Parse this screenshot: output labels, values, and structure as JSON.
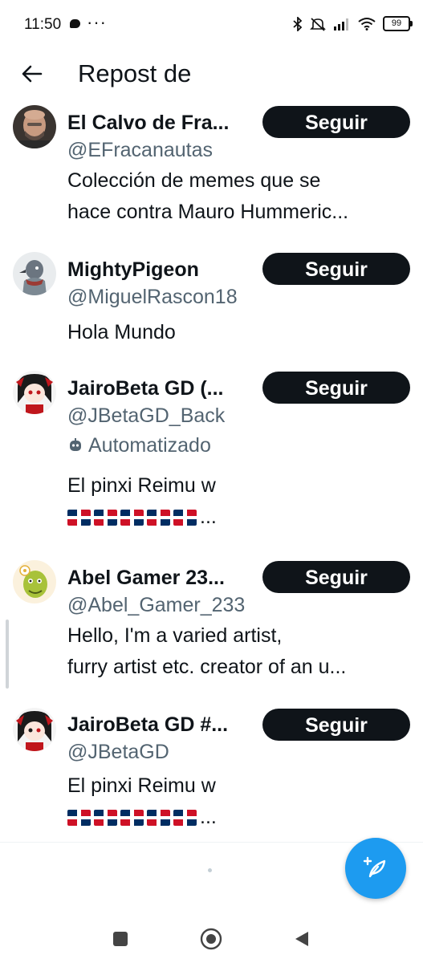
{
  "status_bar": {
    "time": "11:50",
    "dots": "···",
    "battery": "99",
    "icons": [
      "chat-icon",
      "bluetooth-icon",
      "mute-icon",
      "signal-icon",
      "wifi-icon",
      "battery-icon"
    ]
  },
  "header": {
    "title": "Repost de",
    "back_icon": "arrow-left-icon"
  },
  "users": [
    {
      "name": "El Calvo de Fra...",
      "handle": "@EFracanautas",
      "follow_label": "Seguir",
      "bio": [
        "Colección de memes que se",
        "hace contra Mauro Hummeric..."
      ]
    },
    {
      "name": "MightyPigeon",
      "handle": "@MiguelRascon18",
      "follow_label": "Seguir",
      "bio": [
        "Hola Mundo"
      ]
    },
    {
      "name": "JairoBeta GD (...",
      "handle": "@JBetaGD_Back",
      "follow_label": "Seguir",
      "automated_label": "Automatizado",
      "bio": [
        "El pinxi Reimu w"
      ],
      "bio_flags_suffix": "..."
    },
    {
      "name": "Abel Gamer 23...",
      "handle": "@Abel_Gamer_233",
      "follow_label": "Seguir",
      "bio": [
        "Hello, I'm a varied artist,",
        "furry artist etc. creator of an u..."
      ]
    },
    {
      "name": "JairoBeta GD #...",
      "handle": "@JBetaGD",
      "follow_label": "Seguir",
      "bio": [
        "El pinxi Reimu w"
      ],
      "bio_flags_suffix": "..."
    }
  ],
  "colors": {
    "text": "#0f1419",
    "secondary": "#536471",
    "button": "#0f1419",
    "accent": "#1d9bf0"
  },
  "fab": {
    "icon": "compose-feather-icon"
  },
  "navbar": {
    "icons": [
      "recents-square-icon",
      "home-circle-icon",
      "back-triangle-icon"
    ]
  }
}
